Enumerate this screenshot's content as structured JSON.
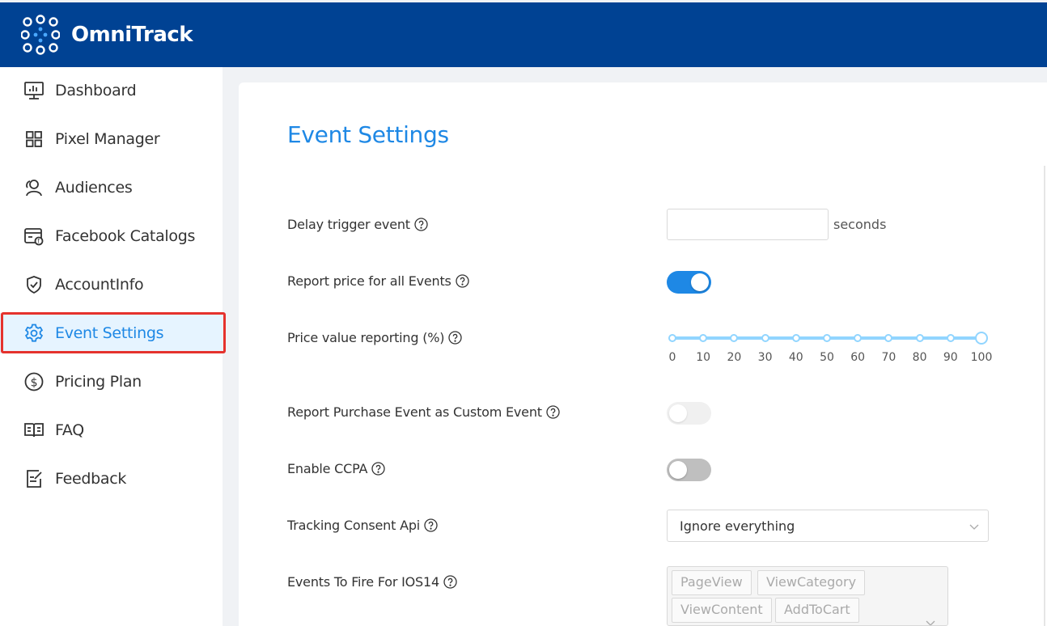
{
  "app": {
    "title": "OmniTrack"
  },
  "sidebar": {
    "items": [
      {
        "label": "Dashboard",
        "icon": "dashboard-monitor-icon"
      },
      {
        "label": "Pixel Manager",
        "icon": "grid-icon"
      },
      {
        "label": "Audiences",
        "icon": "users-icon"
      },
      {
        "label": "Facebook Catalogs",
        "icon": "catalog-icon"
      },
      {
        "label": "AccountInfo",
        "icon": "shield-check-icon"
      },
      {
        "label": "Event Settings",
        "icon": "gear-icon"
      },
      {
        "label": "Pricing Plan",
        "icon": "dollar-icon"
      },
      {
        "label": "FAQ",
        "icon": "book-icon"
      },
      {
        "label": "Feedback",
        "icon": "edit-icon"
      }
    ],
    "active": "Event Settings"
  },
  "page": {
    "title": "Event Settings",
    "settings": {
      "delay": {
        "label": "Delay trigger event",
        "value": "",
        "suffix": "seconds"
      },
      "report_price": {
        "label": "Report price for all Events",
        "enabled": true
      },
      "price_value": {
        "label": "Price value reporting (%)",
        "value": 100,
        "ticks": [
          "0",
          "10",
          "20",
          "30",
          "40",
          "50",
          "60",
          "70",
          "80",
          "90",
          "100"
        ]
      },
      "purchase_custom": {
        "label": "Report Purchase Event as Custom Event",
        "enabled": false,
        "disabled": true
      },
      "ccpa": {
        "label": "Enable CCPA",
        "enabled": false
      },
      "consent_api": {
        "label": "Tracking Consent Api",
        "selected": "Ignore everything"
      },
      "ios14": {
        "label": "Events To Fire For IOS14",
        "tags": [
          "PageView",
          "ViewCategory",
          "ViewContent",
          "AddToCart"
        ]
      }
    }
  },
  "colors": {
    "header": "#004293",
    "accent": "#1e88e5",
    "highlight": "#e5322d",
    "slider": "#91d5ff"
  }
}
